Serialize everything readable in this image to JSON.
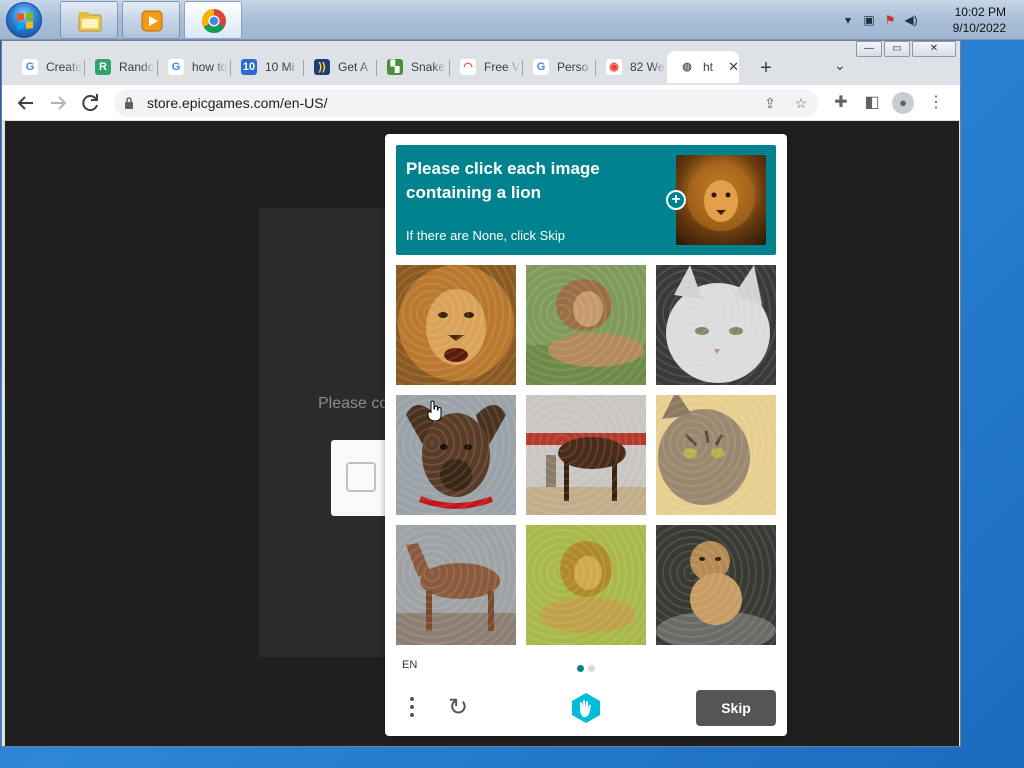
{
  "taskbar": {
    "apps": [
      {
        "name": "windows-explorer-icon"
      },
      {
        "name": "media-player-icon"
      },
      {
        "name": "chrome-icon"
      }
    ],
    "tray_icons": [
      "tray-arrow-icon",
      "network-icon",
      "action-center-icon",
      "volume-icon"
    ],
    "clock_time": "10:02 PM",
    "clock_date": "9/10/2022"
  },
  "browser": {
    "tabs": [
      {
        "title": "Create",
        "favicon": "google-icon"
      },
      {
        "title": "Rando",
        "favicon": "r-icon"
      },
      {
        "title": "how to",
        "favicon": "google-icon"
      },
      {
        "title": "10 Mi",
        "favicon": "10mi-icon"
      },
      {
        "title": "Get A",
        "favicon": "wifi-icon"
      },
      {
        "title": "Snake",
        "favicon": "snake-icon"
      },
      {
        "title": "Free V",
        "favicon": "rainbow-icon"
      },
      {
        "title": "Perso",
        "favicon": "google-icon"
      },
      {
        "title": "82 We",
        "favicon": "maps-pin-icon"
      },
      {
        "title": "ht",
        "favicon": "globe-icon",
        "active": true
      }
    ],
    "new_tab_label": "+",
    "address": "store.epicgames.com/en-US/",
    "window_buttons": {
      "minimize": "—",
      "restore": "▭",
      "close": "✕"
    }
  },
  "page": {
    "partial_text": "Please co"
  },
  "captcha": {
    "prompt": "Please click each image containing a lion",
    "subtext": "If there are None, click Skip",
    "language": "EN",
    "skip_label": "Skip",
    "accent_color": "#00838f",
    "page_dots": 2,
    "current_page": 1,
    "images": [
      {
        "subject": "lion-face"
      },
      {
        "subject": "lion-lying"
      },
      {
        "subject": "white-cat"
      },
      {
        "subject": "dog"
      },
      {
        "subject": "horse-with-rider"
      },
      {
        "subject": "tabby-cat"
      },
      {
        "subject": "horse"
      },
      {
        "subject": "lion-in-grass"
      },
      {
        "subject": "lion-cub"
      }
    ]
  }
}
